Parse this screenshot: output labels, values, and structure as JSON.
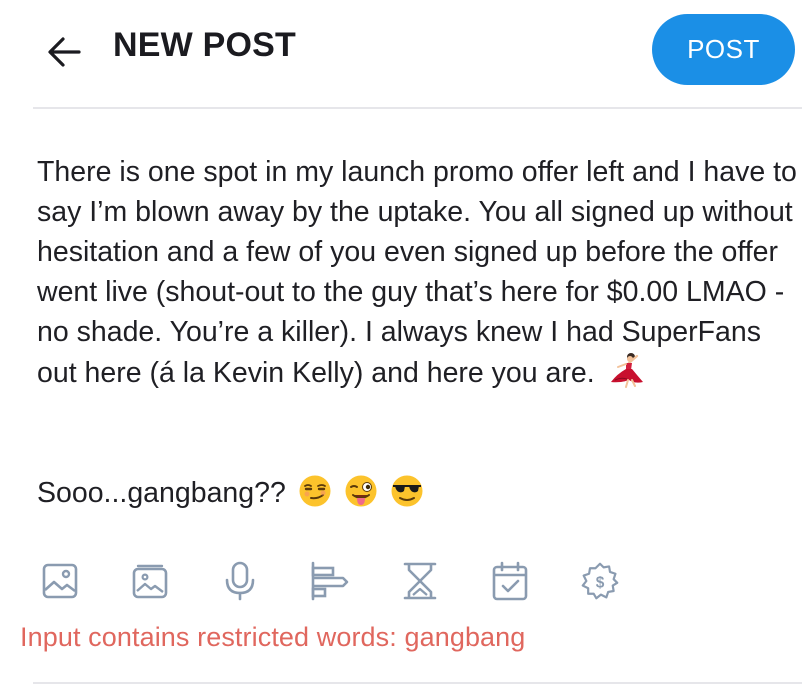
{
  "header": {
    "title": "NEW POST",
    "post_label": "POST",
    "accent_color": "#1b8fe6"
  },
  "post": {
    "paragraph_1": "There is one spot in my launch promo offer left and I have to say I’m blown away by the uptake. You all signed up without hesitation and a few of you even signed up before the offer went live (shout-out to the guy that’s here for $0.00 LMAO - no shade. You’re a killer). I always knew I had SuperFans out here (á la Kevin Kelly) and here you are.",
    "paragraph_1_emoji": "dancer",
    "paragraph_2": "Sooo...gangbang??",
    "paragraph_2_emojis": [
      "smirking-face",
      "winking-face-with-tongue",
      "smiling-face-with-sunglasses"
    ]
  },
  "toolbar": {
    "icons": [
      "image-icon",
      "media-vault-icon",
      "microphone-icon",
      "poll-icon",
      "hourglass-icon",
      "calendar-icon",
      "price-tag-icon"
    ],
    "icon_color": "#8a9bb0"
  },
  "validation": {
    "error": "Input contains restricted words: gangbang",
    "error_color": "#e0675e"
  }
}
